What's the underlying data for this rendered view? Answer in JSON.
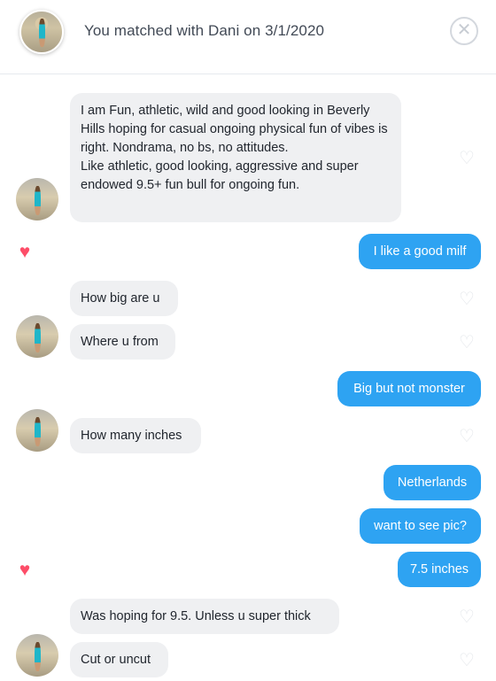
{
  "header": {
    "title": "You matched with Dani on 3/1/2020",
    "close_icon": "close-icon"
  },
  "colors": {
    "incoming_bubble": "#eff0f2",
    "outgoing_bubble": "#2ea3f2",
    "heart_liked": "#fd4d68",
    "heart_empty": "#e2e5e9"
  },
  "messages": [
    {
      "from": "Dani",
      "text": "I am Fun, athletic, wild and good looking in Beverly Hills hoping for casual ongoing physical fun of vibes is right. Nondrama, no bs, no attitudes.\nLike athletic, good looking, aggressive and super endowed 9.5+ fun bull for ongoing fun.",
      "liked": false
    },
    {
      "from": "me",
      "text": "I like a good milf",
      "liked": true
    },
    {
      "from": "Dani",
      "text": "How big are u",
      "liked": false
    },
    {
      "from": "Dani",
      "text": "Where u from",
      "liked": false
    },
    {
      "from": "me",
      "text": "Big but not monster",
      "liked": false
    },
    {
      "from": "Dani",
      "text": "How many inches",
      "liked": false
    },
    {
      "from": "me",
      "text": "Netherlands",
      "liked": false
    },
    {
      "from": "me",
      "text": "want to see pic?",
      "liked": false
    },
    {
      "from": "me",
      "text": "7.5 inches",
      "liked": true
    },
    {
      "from": "Dani",
      "text": "Was hoping for 9.5. Unless u super thick",
      "liked": false
    },
    {
      "from": "Dani",
      "text": "Cut or uncut",
      "liked": false
    }
  ],
  "icons": {
    "heart_outline": "♡",
    "heart_filled": "♥",
    "close": "✕"
  }
}
